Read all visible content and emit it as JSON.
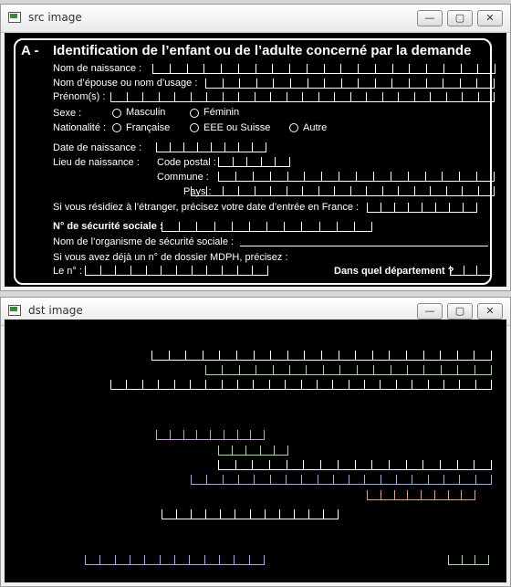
{
  "windows": {
    "src": {
      "title": "src image",
      "btn_min": "—",
      "btn_max": "▢",
      "btn_close": "✕"
    },
    "dst": {
      "title": "dst image",
      "btn_min": "—",
      "btn_max": "▢",
      "btn_close": "✕"
    }
  },
  "form": {
    "section": "A -",
    "heading": "Identification de l’enfant ou de l’adulte concerné par la demande",
    "nom_naissance": "Nom de naissance :",
    "nom_epouse": "Nom d’épouse ou nom d’usage :",
    "prenoms": "Prénom(s) :",
    "sexe": "Sexe :",
    "masculin": "Masculin",
    "feminin": "Féminin",
    "nationalite": "Nationalité :",
    "francaise": "Française",
    "eee": "EEE ou Suisse",
    "autre": "Autre",
    "date_naissance": "Date de naissance :",
    "lieu_naissance": "Lieu de naissance :",
    "code_postal": "Code postal :",
    "commune": "Commune :",
    "pays": "Pays :",
    "etranger": "Si vous résidiez à l’étranger, précisez votre date d’entrée en France :",
    "secu": "N° de sécurité sociale :",
    "organisme": "Nom de l’organisme de sécurité sociale :",
    "dossier": "Si vous avez déjà un n° de dossier MDPH, précisez :",
    "le_no": "Le n° :",
    "departement": "Dans quel département ?"
  },
  "colors": {
    "nom_naissance": "#ffffff",
    "nom_epouse": "#a9dba0",
    "prenoms": "#ffffff",
    "date_naissance": "#c7a0d8",
    "code_postal": "#a9dba0",
    "commune": "#ffffff",
    "pays": "#a6a6f0",
    "etranger": "#e9a08c",
    "secu": "#ffffff",
    "le_no": "#a6a6f0",
    "departement": "#a9dba0"
  }
}
